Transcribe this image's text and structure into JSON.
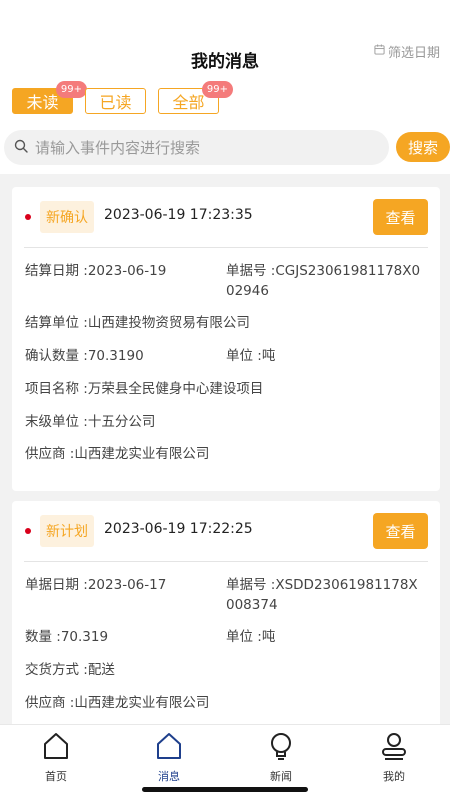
{
  "header": {
    "title": "我的消息",
    "filter_label": "筛选日期",
    "filter_icon": "calendar-icon"
  },
  "tabs": [
    {
      "label": "未读",
      "badge": "99+",
      "active": true
    },
    {
      "label": "已读",
      "badge": "",
      "active": false
    },
    {
      "label": "全部",
      "badge": "99+",
      "active": false
    }
  ],
  "search": {
    "placeholder": "请输入事件内容进行搜索",
    "value": "",
    "button_label": "搜索",
    "icon": "search-icon"
  },
  "messages": [
    {
      "tag": "新确认",
      "time": "2023-06-19 17:23:35",
      "view_label": "查看",
      "fields": {
        "settle_date": "结算日期 :2023-06-19",
        "doc_no": "单据号 :CGJS23061981178X002946",
        "settle_unit": "结算单位 :山西建投物资贸易有限公司",
        "confirm_qty": "确认数量 :70.3190",
        "unit": "单位 :吨",
        "project": "项目名称 :万荣县全民健身中心建设项目",
        "end_unit": "末级单位 :十五分公司",
        "supplier": "供应商 :山西建龙实业有限公司"
      }
    },
    {
      "tag": "新计划",
      "time": "2023-06-19 17:22:25",
      "view_label": "查看",
      "fields": {
        "doc_date": "单据日期 :2023-06-17",
        "doc_no": "单据号 :XSDD23061981178X008374",
        "qty": "数量 :70.319",
        "unit": "单位 :吨",
        "delivery": "交货方式 :配送",
        "supplier": "供应商 :山西建龙实业有限公司"
      }
    }
  ],
  "nav": [
    {
      "label": "首页",
      "icon": "home-icon",
      "active": false
    },
    {
      "label": "消息",
      "icon": "message-icon",
      "active": true
    },
    {
      "label": "新闻",
      "icon": "lightbulb-icon",
      "active": false
    },
    {
      "label": "我的",
      "icon": "user-icon",
      "active": false
    }
  ],
  "colors": {
    "accent": "#f5a623",
    "badge": "#f47b7b",
    "unread_dot": "#d9001b",
    "nav_active": "#1e3f8c"
  }
}
